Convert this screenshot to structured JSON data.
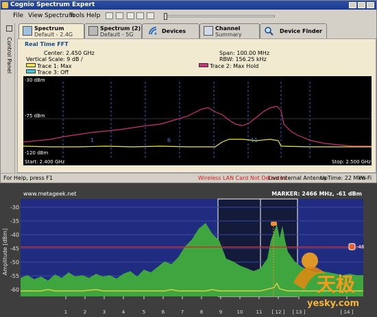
{
  "app": {
    "title": "Cognio Spectrum Expert"
  },
  "menu": {
    "items": [
      "File",
      "View",
      "Spectrum",
      "Tools",
      "Help"
    ]
  },
  "sidebar": {
    "label": "Control Panel"
  },
  "tabs": [
    {
      "title": "Spectrum",
      "subtitle": "Default - 2.4G",
      "active": true
    },
    {
      "title": "Spectrum (2)",
      "subtitle": "Default - 5G",
      "active": false
    },
    {
      "title": "Devices",
      "subtitle": "",
      "active": false
    },
    {
      "title": "Channel",
      "subtitle": "Summary",
      "active": false
    },
    {
      "title": "Device Finder",
      "subtitle": "",
      "active": false
    }
  ],
  "rt": {
    "title": "Real Time FFT",
    "center": "Center: 2.450 GHz",
    "vscale": "Vertical Scale: 9 dB /",
    "span": "Span: 100.00 MHz",
    "rbw": "RBW: 156.25 kHz",
    "legend": [
      {
        "label": "Trace 1: Max",
        "color": "#f2e634"
      },
      {
        "label": "Trace 2: Max Hold",
        "color": "#d0307a"
      },
      {
        "label": "Trace 3: Off",
        "color": "#46c6d6"
      }
    ],
    "y_top": "-30 dBm",
    "y_mid": "-75 dBm",
    "y_bot": "-120 dBm",
    "start": "Start: 2.400 GHz",
    "stop": "Stop: 2.500 GHz",
    "channel_marks": [
      "1",
      "6",
      "11"
    ]
  },
  "status": {
    "help": "For Help, press F1",
    "card": "Wireless LAN Card Not Detected",
    "live": "Live",
    "antenna": "Internal Antenna",
    "uptime": "UpTime: 22 Mins",
    "wifi": "Wi-Fi"
  },
  "wispy": {
    "site": "www.metageek.net",
    "marker": "MARKER: 2466 MHz, -61 dBm",
    "yaxis_label": "Amplitude [dBm]",
    "yticks": [
      "-30",
      "-35",
      "-40",
      "-45",
      "-50",
      "-55",
      "-60"
    ],
    "xticks": [
      "1",
      "2",
      "3",
      "4",
      "5",
      "6",
      "7",
      "8",
      "9",
      "10",
      "11",
      "[ 12 ]",
      "[ 13 ]",
      "[ 14 ]"
    ],
    "threshold_label": "-46",
    "colors": {
      "plot_bg": "#202c80",
      "fill": "#3fa63f",
      "threshold": "#cf2a2a",
      "trace": "#d9cf4a"
    }
  },
  "watermark": {
    "text_cn": "天极",
    "text_en": "yesky.com"
  }
}
